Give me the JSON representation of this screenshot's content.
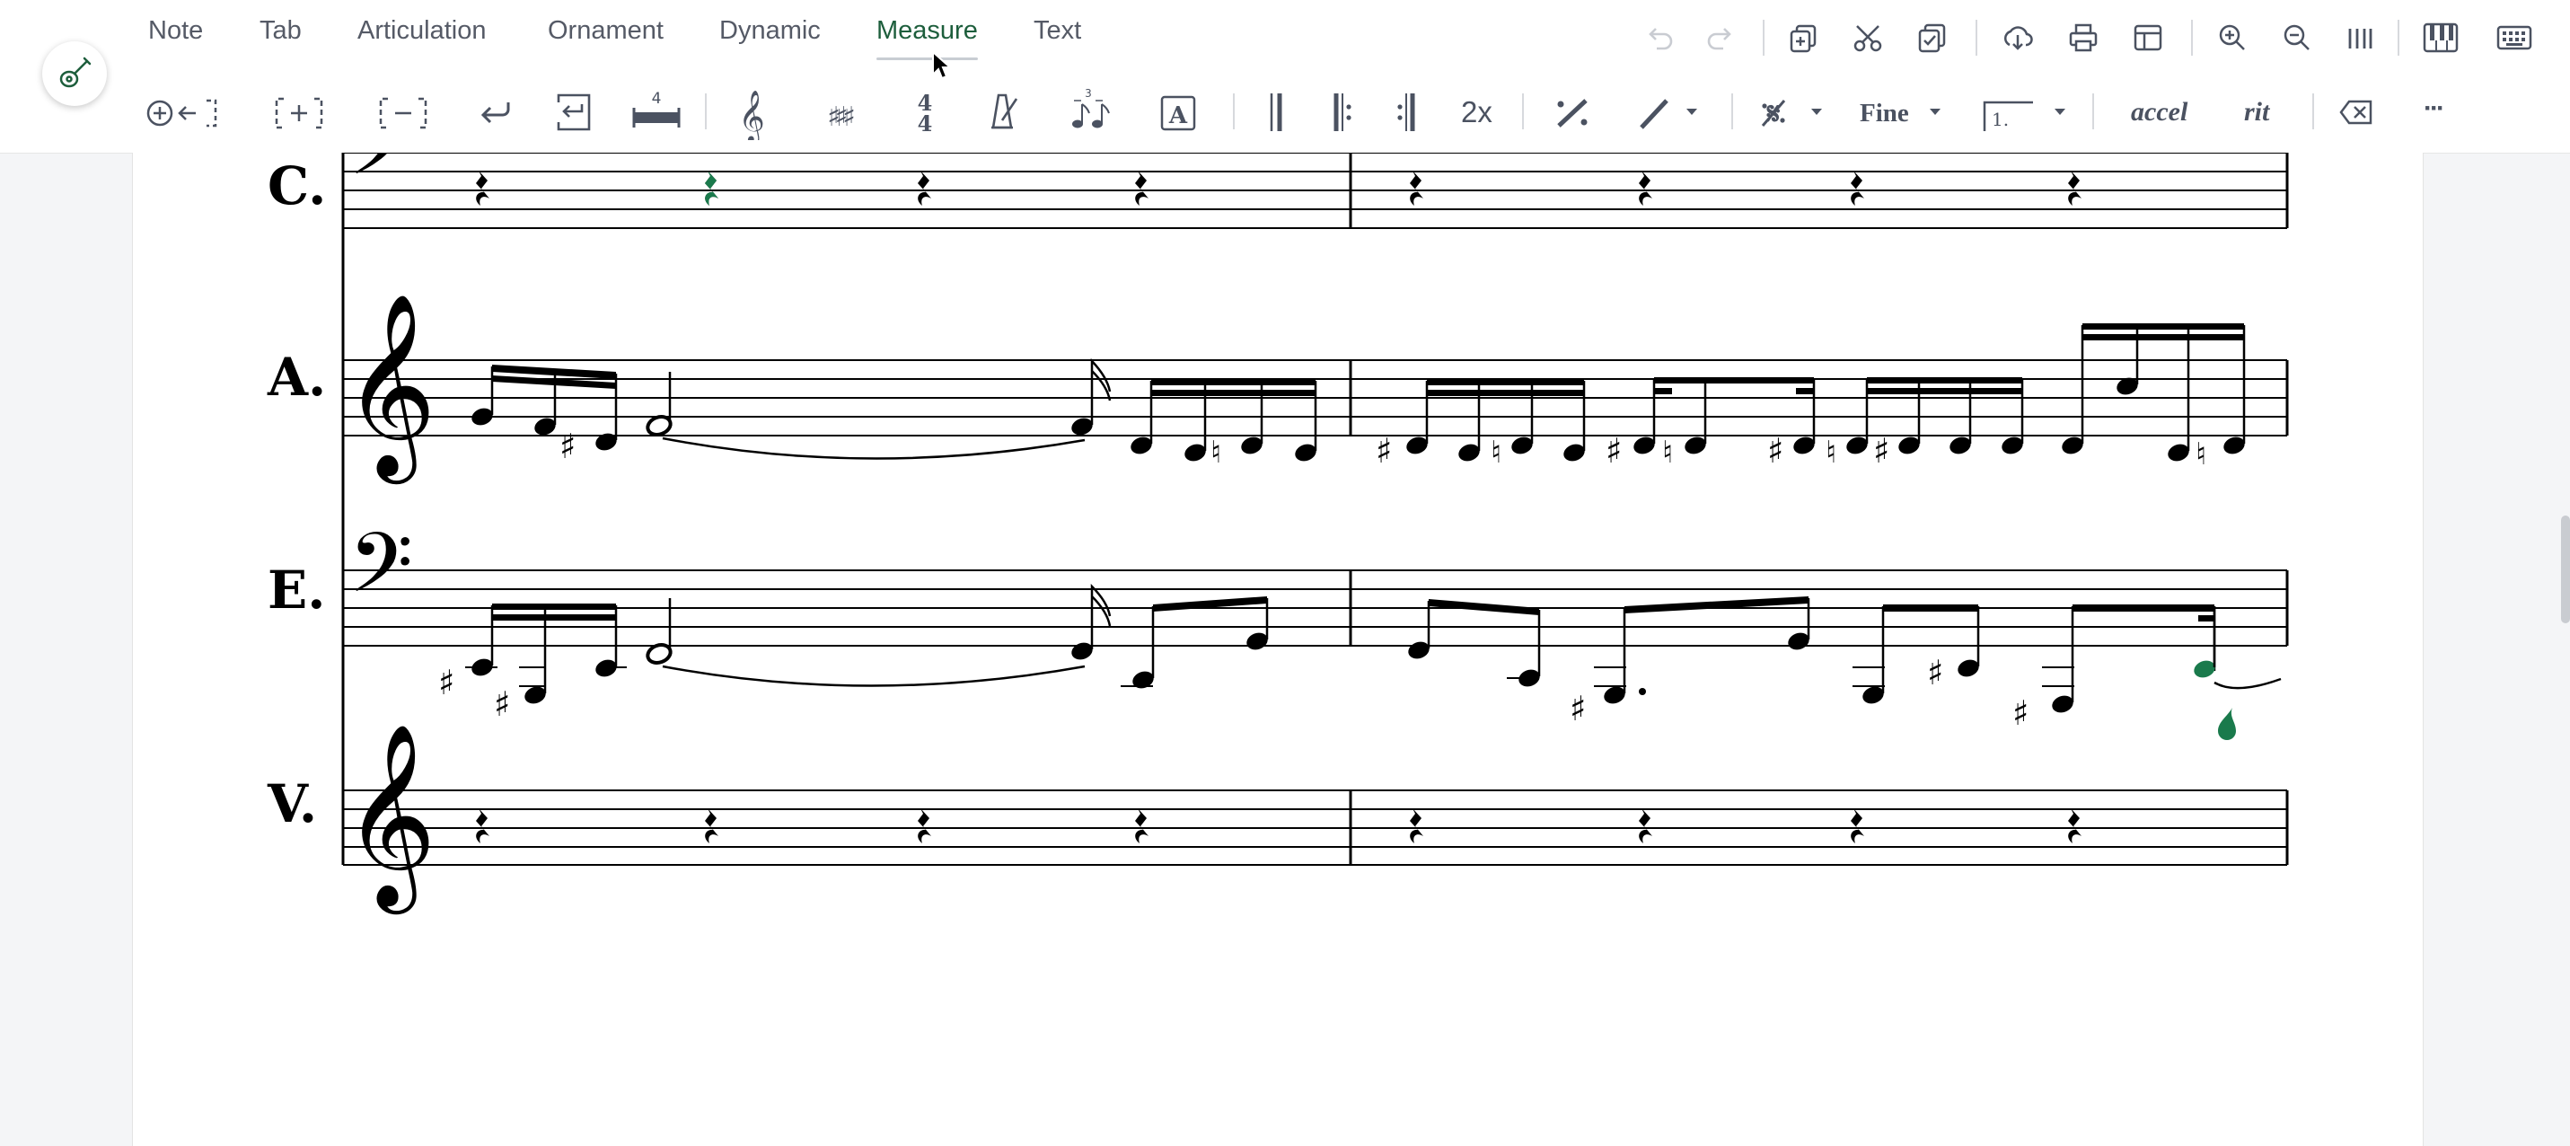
{
  "menu": {
    "tabs": [
      {
        "label": "Note"
      },
      {
        "label": "Tab"
      },
      {
        "label": "Articulation"
      },
      {
        "label": "Ornament"
      },
      {
        "label": "Dynamic"
      },
      {
        "label": "Measure",
        "active": true
      },
      {
        "label": "Text"
      }
    ],
    "right_icons": [
      "undo-icon",
      "redo-icon",
      "copy-icon",
      "cut-icon",
      "paste-icon",
      "download-icon",
      "print-icon",
      "layout-icon",
      "zoom-in-icon",
      "zoom-out-icon",
      "barlines-icon",
      "piano-icon",
      "keyboard-icon"
    ]
  },
  "toolbar": {
    "time_sig_number": "4",
    "repeat_count_label": "2x",
    "fine_label": "Fine",
    "volta_label": "1.",
    "accel_label": "accel",
    "rit_label": "rit",
    "more_label": "···"
  },
  "score": {
    "staves": [
      {
        "label": "C.",
        "clef": "bass"
      },
      {
        "label": "A.",
        "clef": "treble"
      },
      {
        "label": "E.",
        "clef": "bass"
      },
      {
        "label": "V.",
        "clef": "treble"
      }
    ]
  },
  "colors": {
    "accent": "#1d5e3c",
    "selection": "#1a7a4c",
    "icon": "#4b5261",
    "note": "#000000"
  }
}
